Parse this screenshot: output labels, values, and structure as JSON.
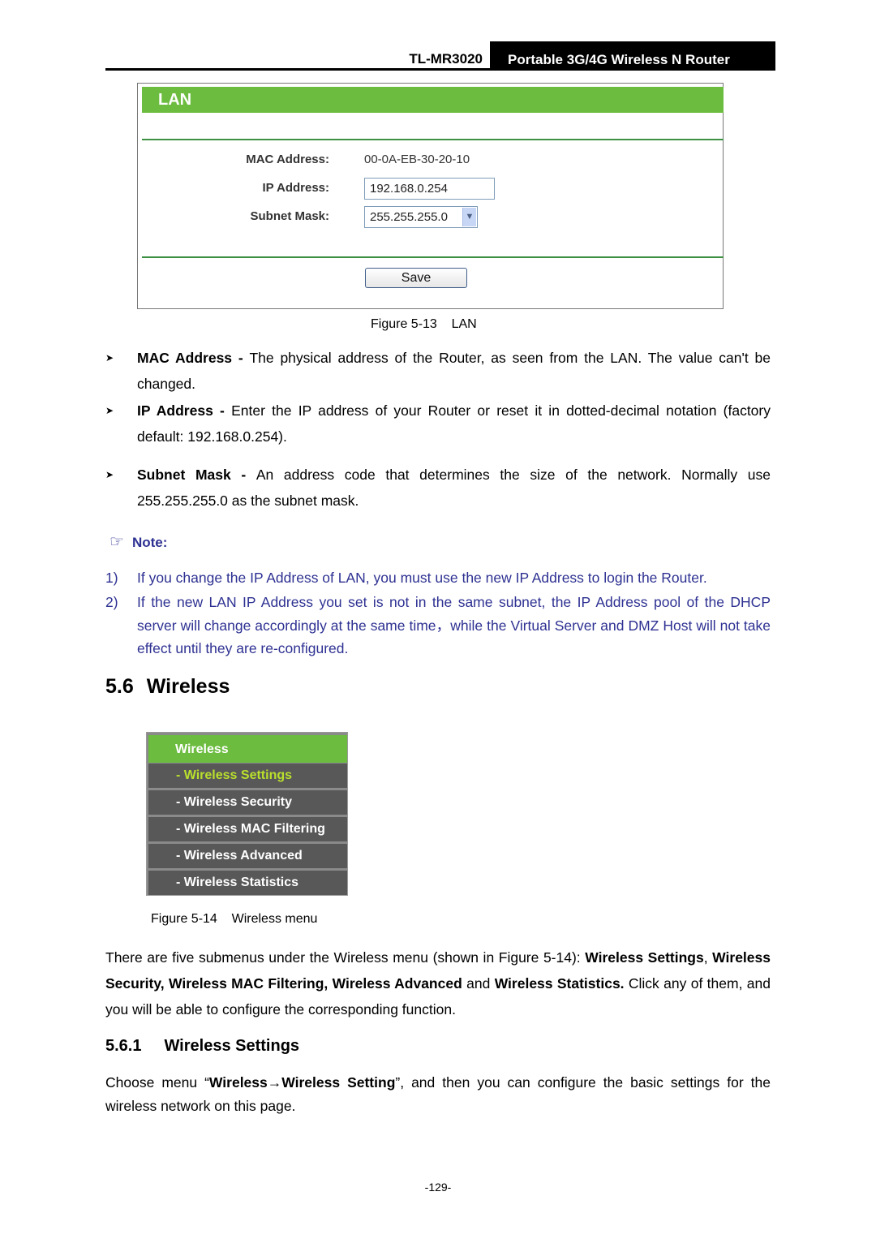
{
  "header": {
    "model": "TL-MR3020",
    "product": "Portable 3G/4G Wireless N Router"
  },
  "lan_figure": {
    "title": "LAN",
    "fields": {
      "mac_label": "MAC Address:",
      "mac_value": "00-0A-EB-30-20-10",
      "ip_label": "IP Address:",
      "ip_value": "192.168.0.254",
      "subnet_label": "Subnet Mask:",
      "subnet_value": "255.255.255.0"
    },
    "save_label": "Save",
    "caption": "Figure 5-13    LAN",
    "colors": {
      "header_green": "#6cbc3f",
      "separator_green": "#3d8f42"
    }
  },
  "bullets": [
    {
      "term": "MAC Address - ",
      "text": "The physical address of the Router, as seen from the LAN. The value can't be changed."
    },
    {
      "term": "IP Address - ",
      "text": "Enter the IP address of your Router or reset it in dotted-decimal notation (factory default: 192.168.0.254)."
    },
    {
      "term": "Subnet Mask - ",
      "text": "An address code that determines the size of the network. Normally use 255.255.255.0 as the subnet mask."
    }
  ],
  "note": {
    "icon": "pointing-hand-icon",
    "label": "Note:",
    "color": "#2e3192",
    "items": [
      {
        "num": "1)",
        "text": "If you change the IP Address of LAN, you must use the new IP Address to login the Router."
      },
      {
        "num": "2)",
        "text": "If the new LAN IP Address you set is not in the same subnet, the IP Address pool of the DHCP server will change accordingly at the same time，while the Virtual Server and DMZ Host will not take effect until they are re-configured."
      }
    ]
  },
  "section": {
    "number": "5.6",
    "title": "Wireless"
  },
  "wireless_menu": {
    "title": "Wireless",
    "items": [
      {
        "label": "- Wireless Settings",
        "active": true
      },
      {
        "label": "- Wireless Security",
        "active": false
      },
      {
        "label": "- Wireless MAC Filtering",
        "active": false
      },
      {
        "label": "- Wireless Advanced",
        "active": false
      },
      {
        "label": "- Wireless Statistics",
        "active": false
      }
    ],
    "caption": "Figure 5-14    Wireless menu"
  },
  "intro_paragraph": {
    "p1": "There are five submenus under the Wireless menu (shown in Figure 5-14): ",
    "b1": "Wireless Settings",
    "p2": ", ",
    "b2": "Wireless Security, Wireless MAC Filtering, Wireless Advanced",
    "p3": " and ",
    "b3": "Wireless Statistics.",
    "p4": " Click any of them, and you will be able to configure the corresponding function."
  },
  "subsection": {
    "number": "5.6.1",
    "title": "Wireless Settings"
  },
  "choose_paragraph": {
    "p1": "Choose menu “",
    "b1": "Wireless→Wireless Setting",
    "p2": "”, and then you can configure the basic settings for the wireless network on this page."
  },
  "footer": {
    "page_number": "-129-"
  }
}
